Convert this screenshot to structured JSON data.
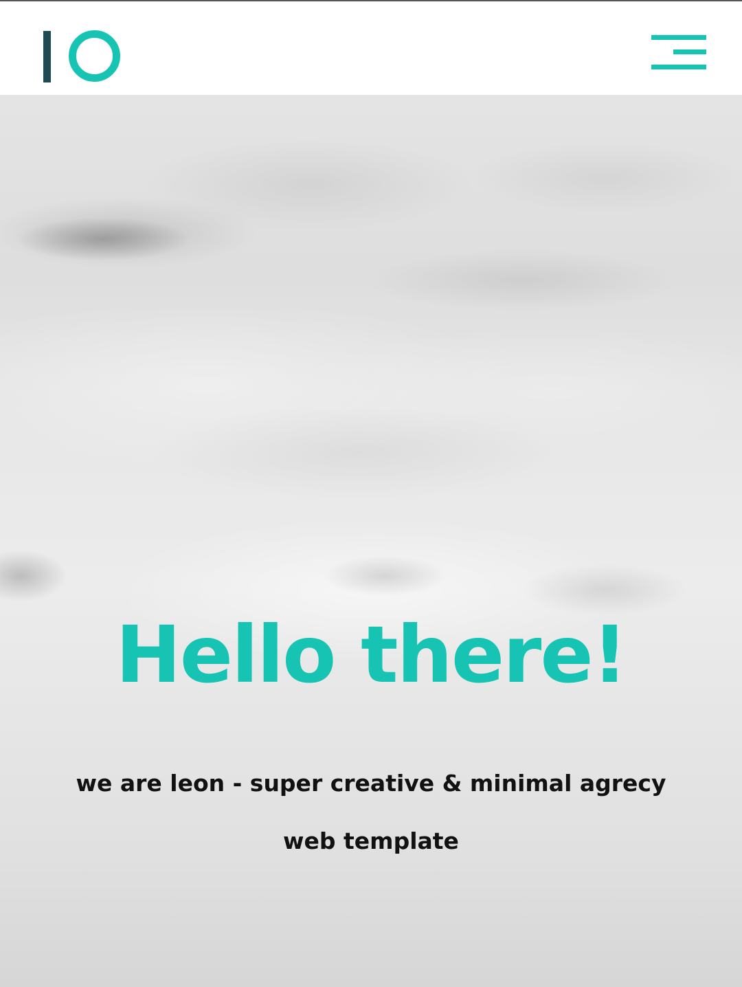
{
  "header": {
    "logo_name": "io-logo",
    "menu_icon": "hamburger-menu-icon"
  },
  "hero": {
    "title": "Hello there!",
    "subtitle": "we are leon - super creative & minimal agrecy web template"
  },
  "colors": {
    "accent": "#17c4b4",
    "logo_bar": "#1f4a55",
    "text_dark": "#111111",
    "header_bg": "#ffffff"
  }
}
